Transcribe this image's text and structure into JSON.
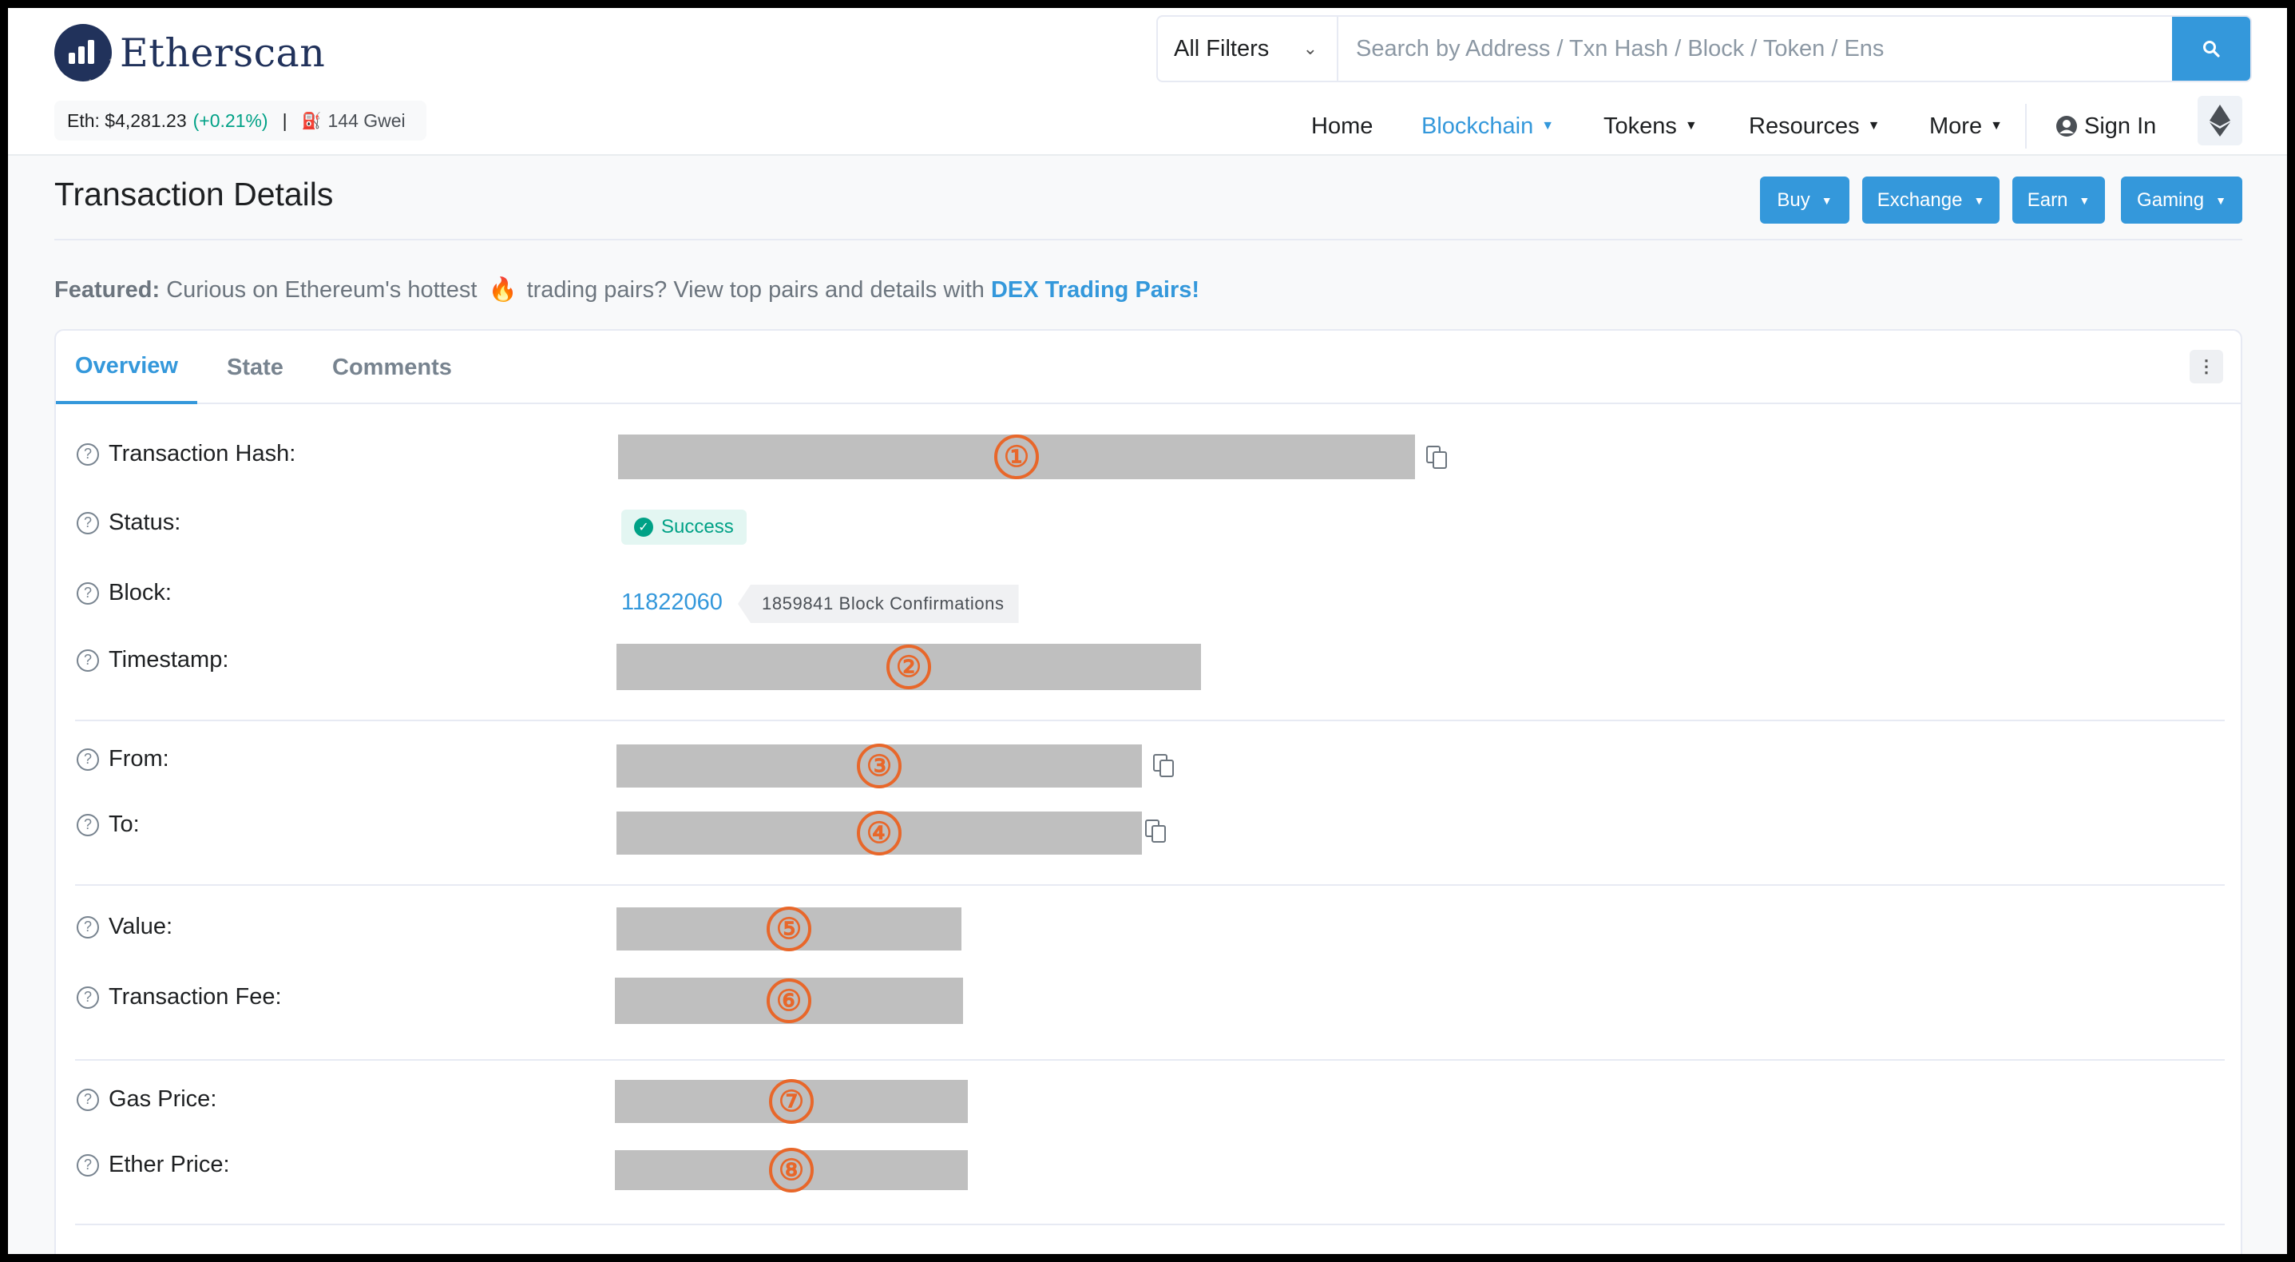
{
  "header": {
    "logo_text": "Etherscan",
    "eth_price_label": "Eth: $4,281.23",
    "eth_price_change": "(+0.21%)",
    "separator": "|",
    "gas_label": "144 Gwei",
    "search": {
      "filter_label": "All Filters",
      "placeholder": "Search by Address / Txn Hash / Block / Token / Ens"
    },
    "nav": {
      "home": "Home",
      "blockchain": "Blockchain",
      "tokens": "Tokens",
      "resources": "Resources",
      "more": "More",
      "sign_in": "Sign In"
    }
  },
  "page": {
    "title": "Transaction Details",
    "actions": {
      "buy": "Buy",
      "exchange": "Exchange",
      "earn": "Earn",
      "gaming": "Gaming"
    },
    "featured": {
      "label": "Featured:",
      "text_before": "Curious on Ethereum's hottest",
      "text_after": "trading pairs? View top pairs and details with",
      "link": "DEX Trading Pairs!"
    }
  },
  "tabs": {
    "overview": "Overview",
    "state": "State",
    "comments": "Comments"
  },
  "details": {
    "tx_hash_label": "Transaction Hash:",
    "status_label": "Status:",
    "status_value": "Success",
    "block_label": "Block:",
    "block_number": "11822060",
    "block_confirmations": "1859841 Block Confirmations",
    "timestamp_label": "Timestamp:",
    "from_label": "From:",
    "to_label": "To:",
    "value_label": "Value:",
    "fee_label": "Transaction Fee:",
    "gas_price_label": "Gas Price:",
    "ether_price_label": "Ether Price:"
  },
  "redaction_markers": {
    "m1": "①",
    "m2": "②",
    "m3": "③",
    "m4": "④",
    "m5": "⑤",
    "m6": "⑥",
    "m7": "⑦",
    "m8": "⑧"
  },
  "colors": {
    "accent": "#3498db",
    "success": "#00a186",
    "marker": "#e8672a",
    "redaction": "#bfbfbf"
  }
}
